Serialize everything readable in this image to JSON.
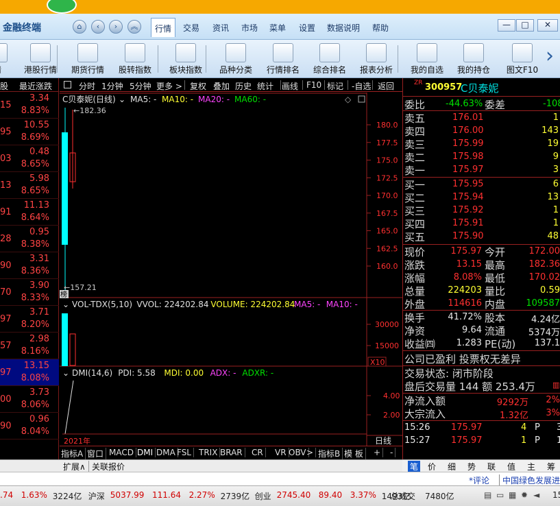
{
  "app": {
    "title": "金融终端"
  },
  "menu": [
    "行情",
    "交易",
    "资讯",
    "市场",
    "菜单",
    "设置",
    "数据说明",
    "帮助"
  ],
  "window_buttons": [
    "—",
    "□",
    "✕"
  ],
  "toolbar": [
    {
      "label": "情",
      "icon": "tv-icon"
    },
    {
      "label": "港股行情",
      "icon": "hk-chart-icon"
    },
    {
      "label": "期货行情",
      "icon": "futures-icon"
    },
    {
      "label": "股转指数",
      "icon": "globe-icon"
    },
    {
      "label": "板块指数",
      "icon": "sector-chart-icon"
    },
    {
      "label": "品种分类",
      "icon": "category-icon"
    },
    {
      "label": "行情排名",
      "icon": "ranking-icon"
    },
    {
      "label": "综合排名",
      "icon": "bar-rank-icon"
    },
    {
      "label": "报表分析",
      "icon": "report-pie-icon"
    },
    {
      "label": "我的自选",
      "icon": "basket-icon"
    },
    {
      "label": "我的持仓",
      "icon": "holdings-icon"
    },
    {
      "label": "图文F10",
      "icon": "f10-icon"
    }
  ],
  "left_list": {
    "header": [
      "股",
      "最近涨跌"
    ],
    "rows": [
      {
        "a": "15",
        "b": "3.34",
        "c": "8.83%"
      },
      {
        "a": "95",
        "b": "10.55",
        "c": "8.69%"
      },
      {
        "a": "03",
        "b": "0.48",
        "c": "8.65%"
      },
      {
        "a": "13",
        "b": "5.98",
        "c": "8.65%"
      },
      {
        "a": "91",
        "b": "11.13",
        "c": "8.64%"
      },
      {
        "a": "28",
        "b": "0.95",
        "c": "8.38%"
      },
      {
        "a": "90",
        "b": "3.31",
        "c": "8.36%"
      },
      {
        "a": "70",
        "b": "3.90",
        "c": "8.33%"
      },
      {
        "a": "97",
        "b": "3.71",
        "c": "8.20%"
      },
      {
        "a": "57",
        "b": "2.98",
        "c": "8.16%"
      },
      {
        "a": "97",
        "b": "13.15",
        "c": "8.08%"
      },
      {
        "a": "00",
        "b": "3.73",
        "c": "8.06%"
      },
      {
        "a": "90",
        "b": "0.96",
        "c": "8.04%"
      }
    ]
  },
  "chart_toolbar": [
    "分时",
    "1分钟",
    "5分钟",
    "更多",
    "复权",
    "叠加",
    "历史",
    "统计",
    "画线",
    "F10",
    "标记",
    "-自选",
    "返回"
  ],
  "main_chart": {
    "name": "C贝泰妮(日线)",
    "ma_labels": [
      {
        "t": "MA5: -",
        "c": "#e0e0e0"
      },
      {
        "t": "MA10: -",
        "c": "#ffff33"
      },
      {
        "t": "MA20: -",
        "c": "#ff44ff"
      },
      {
        "t": "MA60: -",
        "c": "#00e000"
      }
    ],
    "high_label": "182.36",
    "low_label": "157.21",
    "badge": "榜",
    "y_ticks": [
      "180.0",
      "177.5",
      "175.0",
      "172.5",
      "170.0",
      "167.5",
      "165.0",
      "162.5",
      "160.0"
    ],
    "color_up": "#ff3030",
    "color_cyan": "#00ffff"
  },
  "vol_chart": {
    "name": "VOL-TDX(5,10)",
    "labels": [
      {
        "t": "VVOL: 224202.84",
        "c": "#e0e0e0"
      },
      {
        "t": "VOLUME: 224202.84",
        "c": "#ffff33"
      },
      {
        "t": "MA5: -",
        "c": "#ff44ff"
      },
      {
        "t": "MA10: -",
        "c": "#ff44ff"
      }
    ],
    "y_ticks": [
      "30000",
      "15000"
    ],
    "unit": "X10"
  },
  "dmi_chart": {
    "name": "DMI(14,6)",
    "labels": [
      {
        "t": "PDI: 5.58",
        "c": "#e0e0e0"
      },
      {
        "t": "MDI: 0.00",
        "c": "#ffff33"
      },
      {
        "t": "ADX: -",
        "c": "#ff44ff"
      },
      {
        "t": "ADXR: -",
        "c": "#00e000"
      }
    ],
    "y_ticks": [
      "4.00",
      "2.00"
    ],
    "year": "2021年",
    "period": "日线"
  },
  "indicator_tabs": [
    "指标A",
    "窗口",
    "MACD",
    "DMI",
    "DMA",
    "FSL",
    "TRIX",
    "BRAR",
    "CR",
    "VR",
    "OBV",
    ">",
    "指标B",
    "模 板",
    "+",
    "-"
  ],
  "bottom_tabs": [
    "扩展∧",
    "关联报价"
  ],
  "quote": {
    "tag": "ZR",
    "code": "300957",
    "name": "C贝泰妮",
    "weibi_label": "委比",
    "weibi": "-44.63%",
    "weicha_label": "委差",
    "weicha": "-108",
    "asks": [
      {
        "l": "卖五",
        "p": "176.01",
        "v": "1"
      },
      {
        "l": "卖四",
        "p": "176.00",
        "v": "143"
      },
      {
        "l": "卖三",
        "p": "175.99",
        "v": "19"
      },
      {
        "l": "卖二",
        "p": "175.98",
        "v": "9"
      },
      {
        "l": "卖一",
        "p": "175.97",
        "v": "3"
      }
    ],
    "bids": [
      {
        "l": "买一",
        "p": "175.95",
        "v": "6"
      },
      {
        "l": "买二",
        "p": "175.94",
        "v": "13"
      },
      {
        "l": "买三",
        "p": "175.92",
        "v": "1"
      },
      {
        "l": "买四",
        "p": "175.91",
        "v": "1"
      },
      {
        "l": "买五",
        "p": "175.90",
        "v": "48"
      }
    ],
    "stats": [
      {
        "l1": "现价",
        "v1": "175.97",
        "l2": "今开",
        "v2": "172.00"
      },
      {
        "l1": "涨跌",
        "v1": "13.15",
        "l2": "最高",
        "v2": "182.36"
      },
      {
        "l1": "涨幅",
        "v1": "8.08%",
        "l2": "最低",
        "v2": "170.02"
      },
      {
        "l1": "总量",
        "v1": "224203",
        "l2": "量比",
        "v2": "0.59"
      },
      {
        "l1": "外盘",
        "v1": "114616",
        "l2": "内盘",
        "v2": "109587"
      }
    ],
    "stats2": [
      {
        "l1": "换手",
        "v1": "41.72%",
        "l2": "股本",
        "v2": "4.24亿"
      },
      {
        "l1": "净资",
        "v1": "9.64",
        "l2": "流通",
        "v2": "5374万"
      },
      {
        "l1": "收益㈣",
        "v1": "1.283",
        "l2": "PE(动)",
        "v2": "137.1"
      }
    ],
    "profit_note": "公司已盈利 投票权无差异",
    "trade_status": "交易状态: 闭市阶段",
    "after_hours": "盘后交易量 144 额 253.4万",
    "flow": [
      {
        "l": "净流入额",
        "v": "9292万",
        "p": "2%"
      },
      {
        "l": "大宗流入",
        "v": "1.32亿",
        "p": "3%"
      }
    ],
    "ticks": [
      {
        "t": "15:26",
        "p": "175.97",
        "v": "4",
        "s": "P",
        "x": "3"
      },
      {
        "t": "15:27",
        "p": "175.97",
        "v": "1",
        "s": "P",
        "x": "1"
      }
    ],
    "tabs": [
      "笔",
      "价",
      "细",
      "势",
      "联",
      "值",
      "主",
      "筹"
    ]
  },
  "news": [
    "*评论",
    "中国绿色发展进行"
  ],
  "status": {
    "seg1": [
      {
        "t": ".74",
        "c": "#d00000"
      },
      {
        "t": "1.63%",
        "c": "#d00000"
      },
      {
        "t": "3224亿",
        "c": "#222"
      }
    ],
    "hs_label": "沪深",
    "hs": [
      {
        "t": "5037.99",
        "c": "#d00000"
      },
      {
        "t": "111.64",
        "c": "#d00000"
      },
      {
        "t": "2.27%",
        "c": "#d00000"
      },
      {
        "t": "2739亿",
        "c": "#222"
      }
    ],
    "cy_label": "创业",
    "cy": [
      {
        "t": "2745.40",
        "c": "#d00000"
      },
      {
        "t": "89.40",
        "c": "#d00000"
      },
      {
        "t": "3.37%",
        "c": "#d00000"
      },
      {
        "t": "1493亿",
        "c": "#222"
      }
    ],
    "total_label": "总成交",
    "total": "7480亿",
    "time": "15"
  }
}
